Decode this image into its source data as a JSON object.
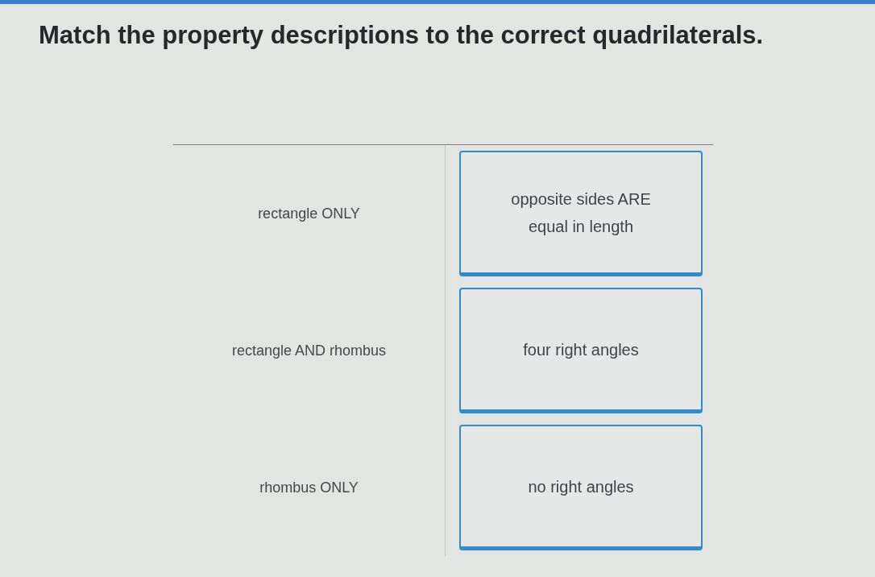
{
  "question": {
    "title": "Match the property descriptions to the correct quadrilaterals."
  },
  "matching": {
    "targets": [
      {
        "label": "rectangle ONLY"
      },
      {
        "label": "rectangle AND rhombus"
      },
      {
        "label": "rhombus ONLY"
      }
    ],
    "cards": [
      {
        "text": "opposite sides ARE equal in length"
      },
      {
        "text": "four right angles"
      },
      {
        "text": "no right angles"
      }
    ]
  }
}
